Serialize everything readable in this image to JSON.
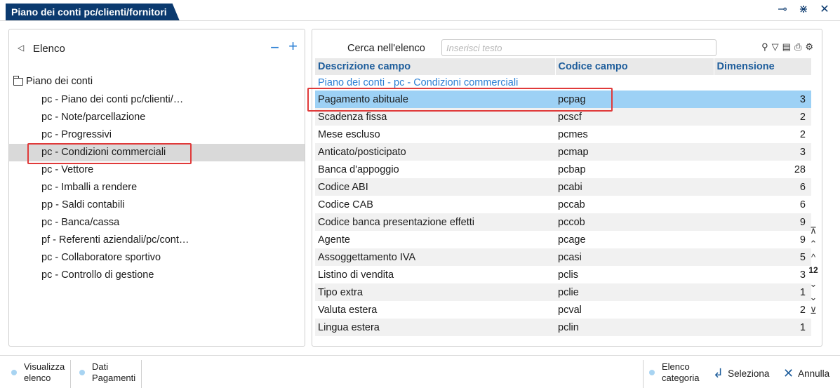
{
  "window": {
    "title": "Piano dei conti pc/clienti/fornitori",
    "icons": [
      "pin-icon",
      "minimize-icon",
      "close-icon"
    ]
  },
  "left": {
    "title": "Elenco",
    "tree_root": "Piano dei conti",
    "items": [
      "pc - Piano dei conti pc/clienti/…",
      "pc - Note/parcellazione",
      "pc - Progressivi",
      "pc - Condizioni commerciali",
      "pc - Vettore",
      "pc - Imballi a rendere",
      "pp - Saldi contabili",
      "pc - Banca/cassa",
      "pf - Referenti aziendali/pc/cont…",
      "pc - Collaboratore sportivo",
      "pc - Controllo di gestione"
    ],
    "selected_index": 3
  },
  "search": {
    "label": "Cerca nell'elenco",
    "placeholder": "Inserisci testo"
  },
  "table": {
    "columns": [
      "Descrizione campo",
      "Codice campo",
      "Dimensione"
    ],
    "group_label": "Piano dei conti - pc - Condizioni commerciali",
    "rows": [
      [
        "Pagamento abituale",
        "pcpag",
        "3"
      ],
      [
        "Scadenza fissa",
        "pcscf",
        "2"
      ],
      [
        "Mese escluso",
        "pcmes",
        "2"
      ],
      [
        "Anticato/posticipato",
        "pcmap",
        "3"
      ],
      [
        "Banca d'appoggio",
        "pcbap",
        "28"
      ],
      [
        "Codice ABI",
        "pcabi",
        "6"
      ],
      [
        "Codice CAB",
        "pccab",
        "6"
      ],
      [
        "Codice banca presentazione effetti",
        "pccob",
        "9"
      ],
      [
        "Agente",
        "pcage",
        "9"
      ],
      [
        "Assoggettamento IVA",
        "pcasi",
        "5"
      ],
      [
        "Listino di vendita",
        "pclis",
        "3"
      ],
      [
        "Tipo extra",
        "pclie",
        "1"
      ],
      [
        "Valuta estera",
        "pcval",
        "2"
      ],
      [
        "Lingua estera",
        "pclin",
        "1"
      ]
    ],
    "selected_row": 0
  },
  "scroll": {
    "page": "12"
  },
  "bottom": {
    "visualizza_line1": "Visualizza",
    "visualizza_line2": "elenco",
    "dati_line1": "Dati",
    "dati_line2": "Pagamenti",
    "elenco_cat_line1": "Elenco",
    "elenco_cat_line2": "categoria",
    "seleziona": "Seleziona",
    "annulla": "Annulla"
  },
  "colors": {
    "title_bg": "#0b3a6f",
    "accent_blue": "#2a7fd4",
    "header_text": "#1f5e9c",
    "selected_row": "#9dd1f5",
    "highlight_red": "#e03a3a"
  }
}
